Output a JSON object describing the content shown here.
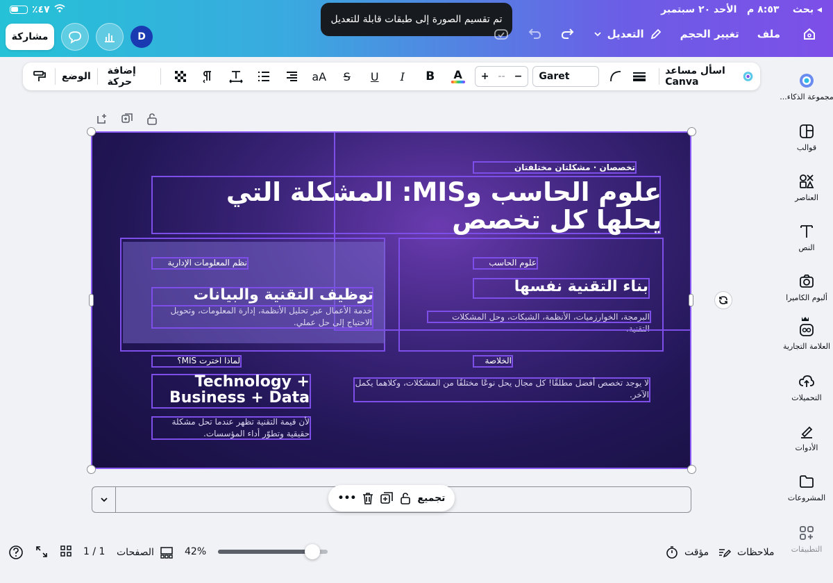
{
  "status": {
    "time": "٨:٥٣ م",
    "date": "الأحد ٢٠ سبتمبر",
    "back": "◂ بحث",
    "battery": "٪٤٧"
  },
  "toast": "تم تقسيم الصورة إلى طبقات قابلة للتعديل",
  "topnav": {
    "file": "ملف",
    "resize": "تغيير الحجم",
    "edit": "التعديل"
  },
  "top_left": {
    "share": "مشاركة",
    "avatar": "D"
  },
  "toolbar": {
    "ask_canva": "اسأل مساعد Canva",
    "font": "Garet",
    "size_minus": "−",
    "size_value": "--",
    "size_plus": "+",
    "text_size": "aA",
    "bold": "B",
    "italic": "I",
    "underline": "U",
    "strike": "S",
    "add_animation": "إضافة حركة",
    "position": "الوضع"
  },
  "sidebar": {
    "items": [
      {
        "label": "مجموعة الذكاء...",
        "icon": "magic-icon"
      },
      {
        "label": "قوالب",
        "icon": "templates-icon"
      },
      {
        "label": "العناصر",
        "icon": "elements-icon"
      },
      {
        "label": "النص",
        "icon": "text-icon"
      },
      {
        "label": "ألبوم الكاميرا",
        "icon": "camera-icon"
      },
      {
        "label": "العلامة التجارية",
        "icon": "brand-icon"
      },
      {
        "label": "التحميلات",
        "icon": "upload-icon"
      },
      {
        "label": "الأدوات",
        "icon": "tools-icon"
      },
      {
        "label": "المشروعات",
        "icon": "folder-icon"
      },
      {
        "label": "التطبيقات",
        "icon": "apps-icon"
      }
    ]
  },
  "slide": {
    "kicker": "تخصصان · مشكلتان مختلفتان",
    "title": "علوم الحاسب وMIS: المشكلة التي يحلها كل تخصص",
    "mis_label": "نظم المعلومات الإدارية",
    "mis_title": "توظيف التقنية والبيانات",
    "mis_desc": "خدمة الأعمال عبر تحليل الأنظمة، إدارة المعلومات، وتحويل الاحتياج إلى حل عملي.",
    "cs_label": "علوم الحاسب",
    "cs_title": "بناء التقنية نفسها",
    "cs_desc": "البرمجة، الخوارزميات، الأنظمة، الشبكات، وحل المشكلات التقنية.",
    "why_label": "لماذا اخترت MIS؟",
    "why_title_1": "Technology +",
    "why_title_2": "Business + Data",
    "why_desc": "لأن قيمة التقنية تظهر عندما تحل مشكلة حقيقية وتطوّر أداء المؤسسات.",
    "summary_label": "الخلاصة",
    "summary_desc": "لا يوجد تخصص أفضل مطلقًا! كل مجال يحل نوعًا مختلفًا من المشكلات، وكلاهما يكمل الآخر."
  },
  "context_menu": {
    "group": "تجميع",
    "more": "•••"
  },
  "footer": {
    "notes": "ملاحظات",
    "timer": "مؤقت",
    "zoom": "42%",
    "zoom_fraction": 0.42,
    "pages": "الصفحات",
    "page_count": "1 / 1"
  }
}
